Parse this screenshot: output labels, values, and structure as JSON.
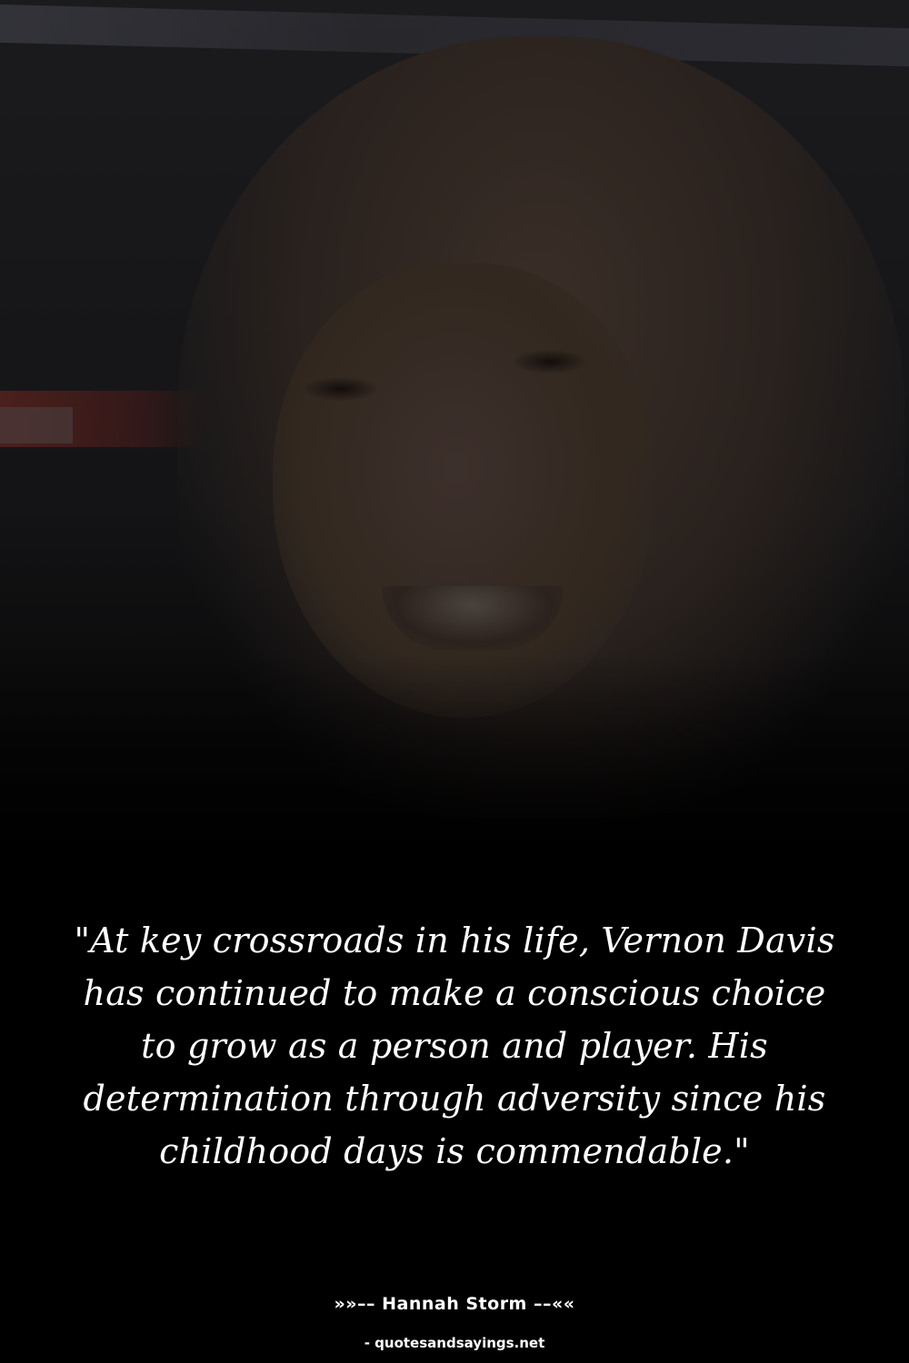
{
  "quote": {
    "text": "\"At key crossroads in his life, Vernon Davis has continued to make a conscious choice to grow as a person and player. His determination through adversity since his childhood days is commendable.\""
  },
  "attribution": {
    "author": "»»–– Hannah Storm ––««"
  },
  "footer": {
    "source": "- quotesandsayings.net"
  },
  "colors": {
    "background": "#000000",
    "text": "#ffffff"
  }
}
